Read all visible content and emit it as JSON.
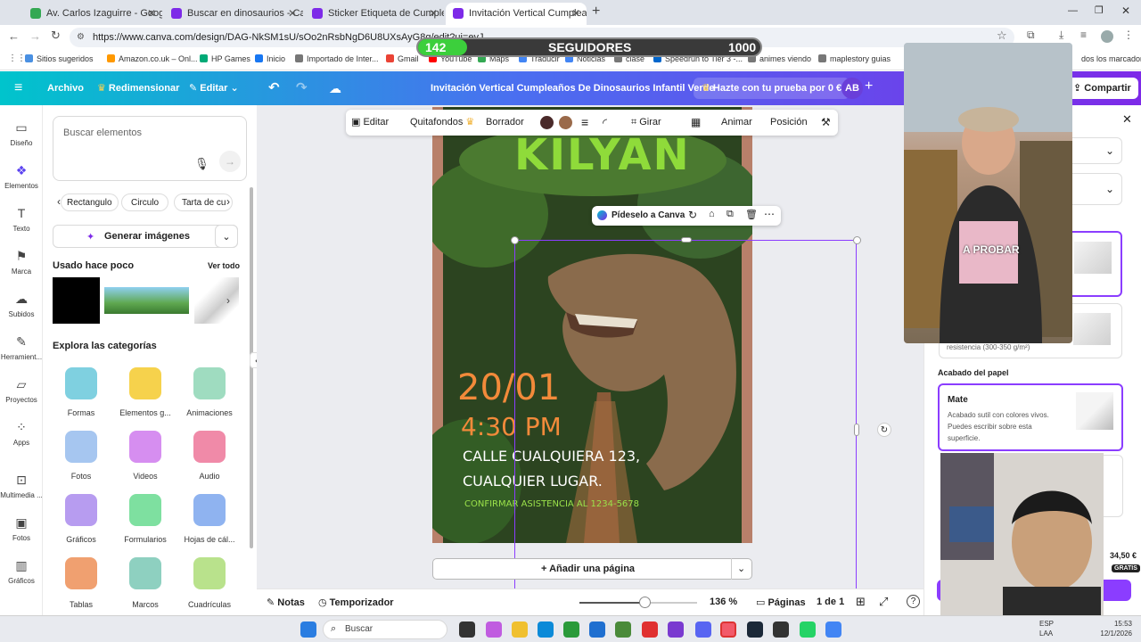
{
  "browser": {
    "tabs": [
      {
        "label": "Av. Carlos Izaguirre - Google M",
        "color": "#34a853"
      },
      {
        "label": "Buscar en dinosaurios - Canva",
        "color": "#7d2ae8"
      },
      {
        "label": "Sticker Etiqueta de Cumpleaño",
        "color": "#7d2ae8"
      },
      {
        "label": "Invitación Vertical Cumpleaños",
        "color": "#7d2ae8"
      }
    ],
    "url": "https://www.canva.com/design/DAG-NkSM1sU/sOo2nRsbNgD6U8UXsAyG8g/edit?ui=eyJ...",
    "bookmarks": [
      "Sitios sugeridos",
      "Amazon.co.uk – Onl...",
      "HP Games",
      "Inicio",
      "Importado de Inter...",
      "Gmail",
      "YouTube",
      "Maps",
      "Traducir",
      "Noticias",
      "clase",
      "Speedrun to Tier 3 -...",
      "animes viendo",
      "maplestory guias",
      "dos los marcadores"
    ]
  },
  "overlay": {
    "left_count": "142",
    "label": "SEGUIDORES",
    "right_count": "1000",
    "webcam_caption": "A PROBAR"
  },
  "header": {
    "archivo": "Archivo",
    "redimensionar": "Redimensionar",
    "editar": "Editar",
    "title": "Invitación Vertical Cumpleaños De Dinosaurios Infantil Verde",
    "trial": "Hazte con tu prueba por 0 €",
    "avatar": "AB",
    "share": "Compartir"
  },
  "rail": [
    "Diseño",
    "Elementos",
    "Texto",
    "Marca",
    "Subidos",
    "Herramient...",
    "Proyectos",
    "Apps",
    "Multimedia ...",
    "Fotos",
    "Gráficos"
  ],
  "panel": {
    "search_placeholder": "Buscar elementos",
    "chips": [
      "Rectangulo",
      "Circulo",
      "Tarta de cu"
    ],
    "generate": "Generar imágenes",
    "recent_title": "Usado hace poco",
    "see_all": "Ver todo",
    "categories_title": "Explora las categorías",
    "categories": [
      {
        "label": "Formas",
        "color": "#7fd0e0"
      },
      {
        "label": "Elementos g...",
        "color": "#f6d24c"
      },
      {
        "label": "Animaciones",
        "color": "#9fdcc0"
      },
      {
        "label": "Fotos",
        "color": "#a6c6f0"
      },
      {
        "label": "Videos",
        "color": "#d68ef0"
      },
      {
        "label": "Audio",
        "color": "#f08aa8"
      },
      {
        "label": "Gráficos",
        "color": "#b79cf0"
      },
      {
        "label": "Formularios",
        "color": "#7ee0a0"
      },
      {
        "label": "Hojas de cál...",
        "color": "#8fb3f0"
      },
      {
        "label": "Tablas",
        "color": "#f0a070"
      },
      {
        "label": "Marcos",
        "color": "#8ed0c0"
      },
      {
        "label": "Cuadrículas",
        "color": "#b9e28c"
      }
    ]
  },
  "toolbar": [
    "Editar",
    "Quitafondos",
    "Borrador",
    "Girar",
    "Animar",
    "Posición"
  ],
  "float_menu": {
    "label": "Pídeselo a Canva"
  },
  "invite": {
    "name": "KILYAN",
    "date": "20/01",
    "time": "4:30 PM",
    "address1": "CALLE CUALQUIERA 123,",
    "address2": "CUALQUIER LUGAR.",
    "rsvp": "CONFIRMAR ASISTENCIA AL 1234-5678"
  },
  "add_page": "+ Añadir una página",
  "bottombar": {
    "notes": "Notas",
    "timer": "Temporizador",
    "zoom": "136 %",
    "pages": "Páginas",
    "page_count": "1 de 1",
    "zoom_level": 0.55
  },
  "rpanel": {
    "paper_finish": "Acabado del papel",
    "mate_title": "Mate",
    "mate_desc": "Acabado sutil con colores vivos. Puedes escribir sobre esta superficie.",
    "resist": "resistencia (300-350 g/m²)",
    "price": "34,50 €",
    "badge": "GRATIS"
  },
  "taskbar": {
    "search": "Buscar",
    "lang": "ESP",
    "lang2": "LAA",
    "time": "15:53",
    "date": "12/1/2026"
  }
}
